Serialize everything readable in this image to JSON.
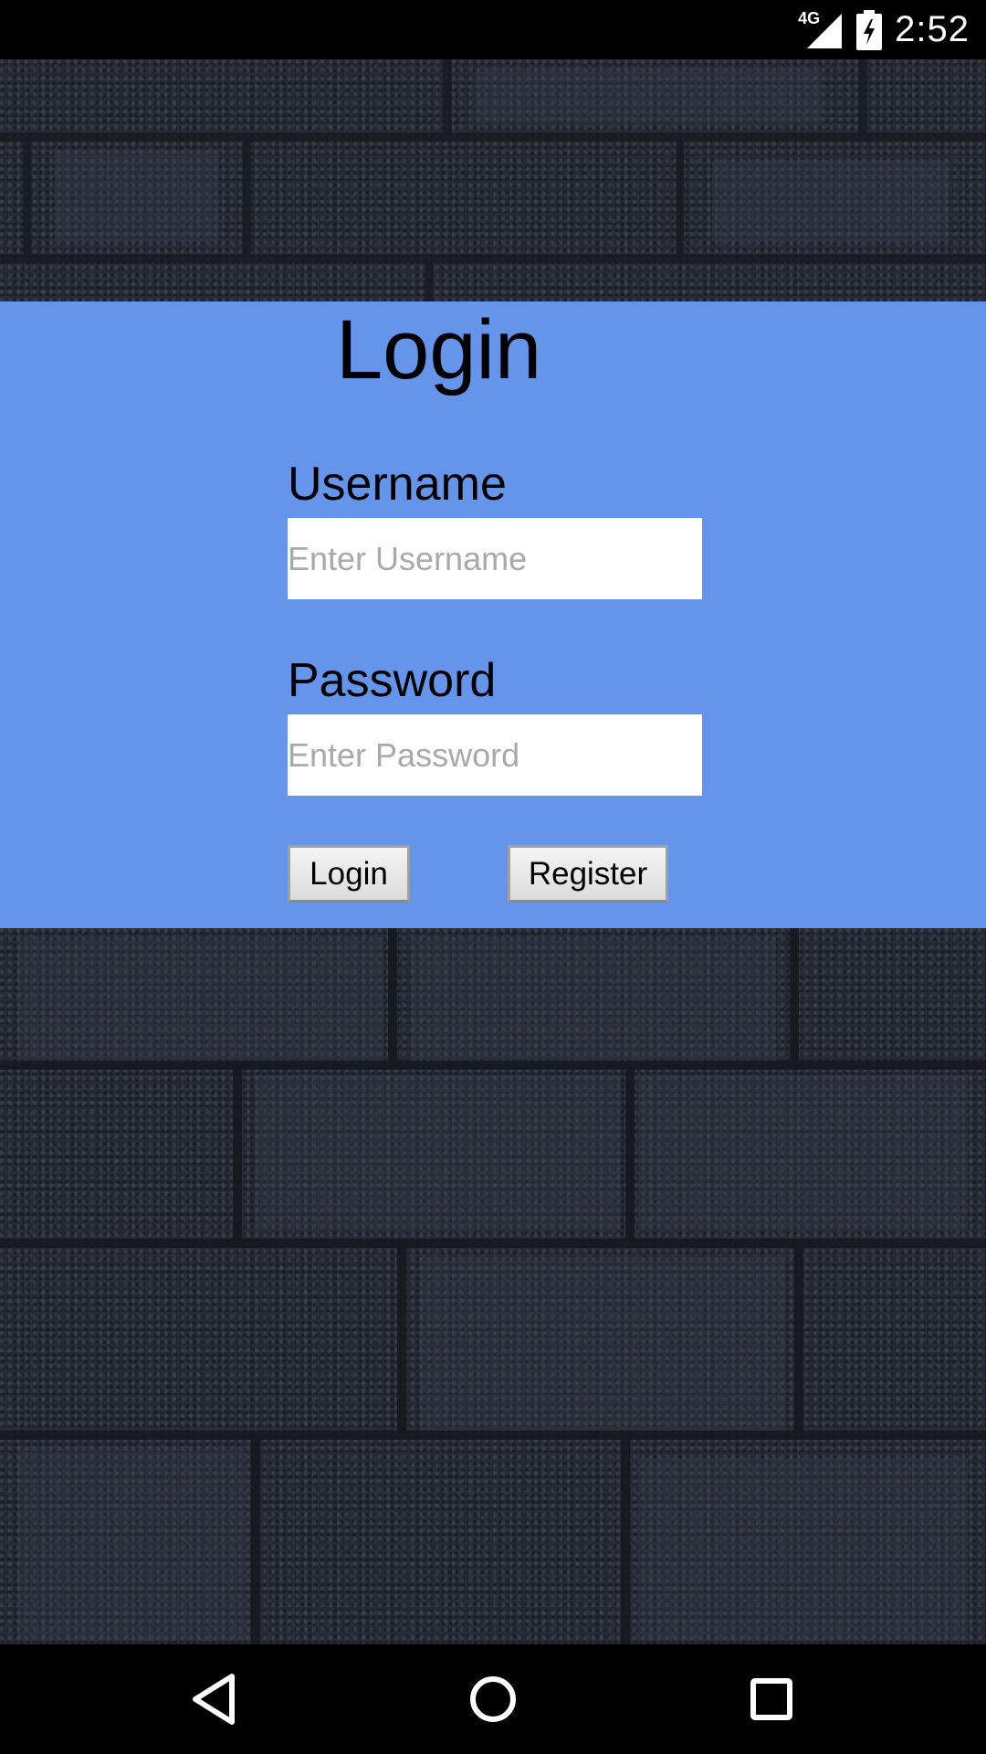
{
  "status_bar": {
    "network_type": "4G",
    "time": "2:52",
    "icons": [
      "signal-icon",
      "battery-charging-icon"
    ]
  },
  "login": {
    "title": "Login",
    "username_label": "Username",
    "username_placeholder": "Enter Username",
    "username_value": "",
    "password_label": "Password",
    "password_placeholder": "Enter Password",
    "password_value": "",
    "login_button": "Login",
    "register_button": "Register"
  },
  "nav_bar": {
    "icons": [
      "back-icon",
      "home-icon",
      "recents-icon"
    ]
  },
  "colors": {
    "panel_background": "#6495ea",
    "wall_background": "#262a35",
    "system_bars": "#000000"
  }
}
